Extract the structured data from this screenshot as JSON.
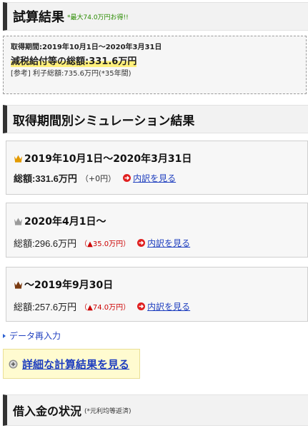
{
  "result_header": {
    "title": "試算結果",
    "note": "*最大74.0万円お得!!"
  },
  "summary": {
    "period": "取得期間:2019年10月1日～2020年3月31日",
    "total_label": "減税給付等の総額:",
    "total_value": "331.6万円",
    "reference": "[参考] 利子総額:735.6万円(*35年間)"
  },
  "simulation_header": {
    "title": "取得期間別シミュレーション結果"
  },
  "simulations": [
    {
      "crown": "gold-crown-icon",
      "crown_color": "#e39a00",
      "period": "2019年10月1日～2020年3月31日",
      "total": "総額:331.6万円",
      "diff": "（+0円）",
      "detail_link": "内訳を見る"
    },
    {
      "crown": "silver-crown-icon",
      "crown_color": "#9a9a9a",
      "period": "2020年4月1日～",
      "total": "総額:296.6万円",
      "diff": "（▲35.0万円）",
      "detail_link": "内訳を見る"
    },
    {
      "crown": "bronze-crown-icon",
      "crown_color": "#7a3a10",
      "period": "～2019年9月30日",
      "total": "総額:257.6万円",
      "diff": "（▲74.0万円）",
      "detail_link": "内訳を見る"
    }
  ],
  "reinput_link": "データ再入力",
  "detail_button": "詳細な計算結果を見る",
  "loan_header": {
    "title": "借入金の状況",
    "note": "(*元利均等返済)"
  },
  "colors": {
    "link": "#1f3fbf",
    "red": "#cc0000",
    "highlight": "#ffef7a",
    "accent_bar": "#333333"
  }
}
